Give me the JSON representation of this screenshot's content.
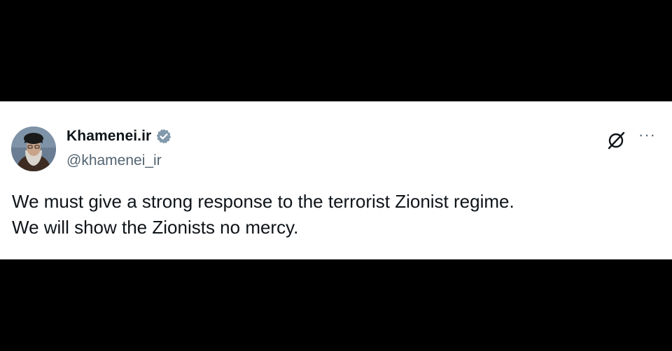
{
  "tweet": {
    "author": {
      "display_name": "Khamenei.ir",
      "handle": "@khamenei_ir",
      "verified_icon": "verified-badge-icon",
      "verified_color": "#829aab"
    },
    "text_lines": [
      "We must give a strong response to the terrorist Zionist regime.",
      "We will show the Zionists no mercy."
    ],
    "actions": {
      "grok_icon": "grok-icon",
      "more_label": "···"
    }
  },
  "colors": {
    "background": "#000000",
    "card": "#ffffff",
    "primary_text": "#0f1419",
    "secondary_text": "#536471"
  }
}
